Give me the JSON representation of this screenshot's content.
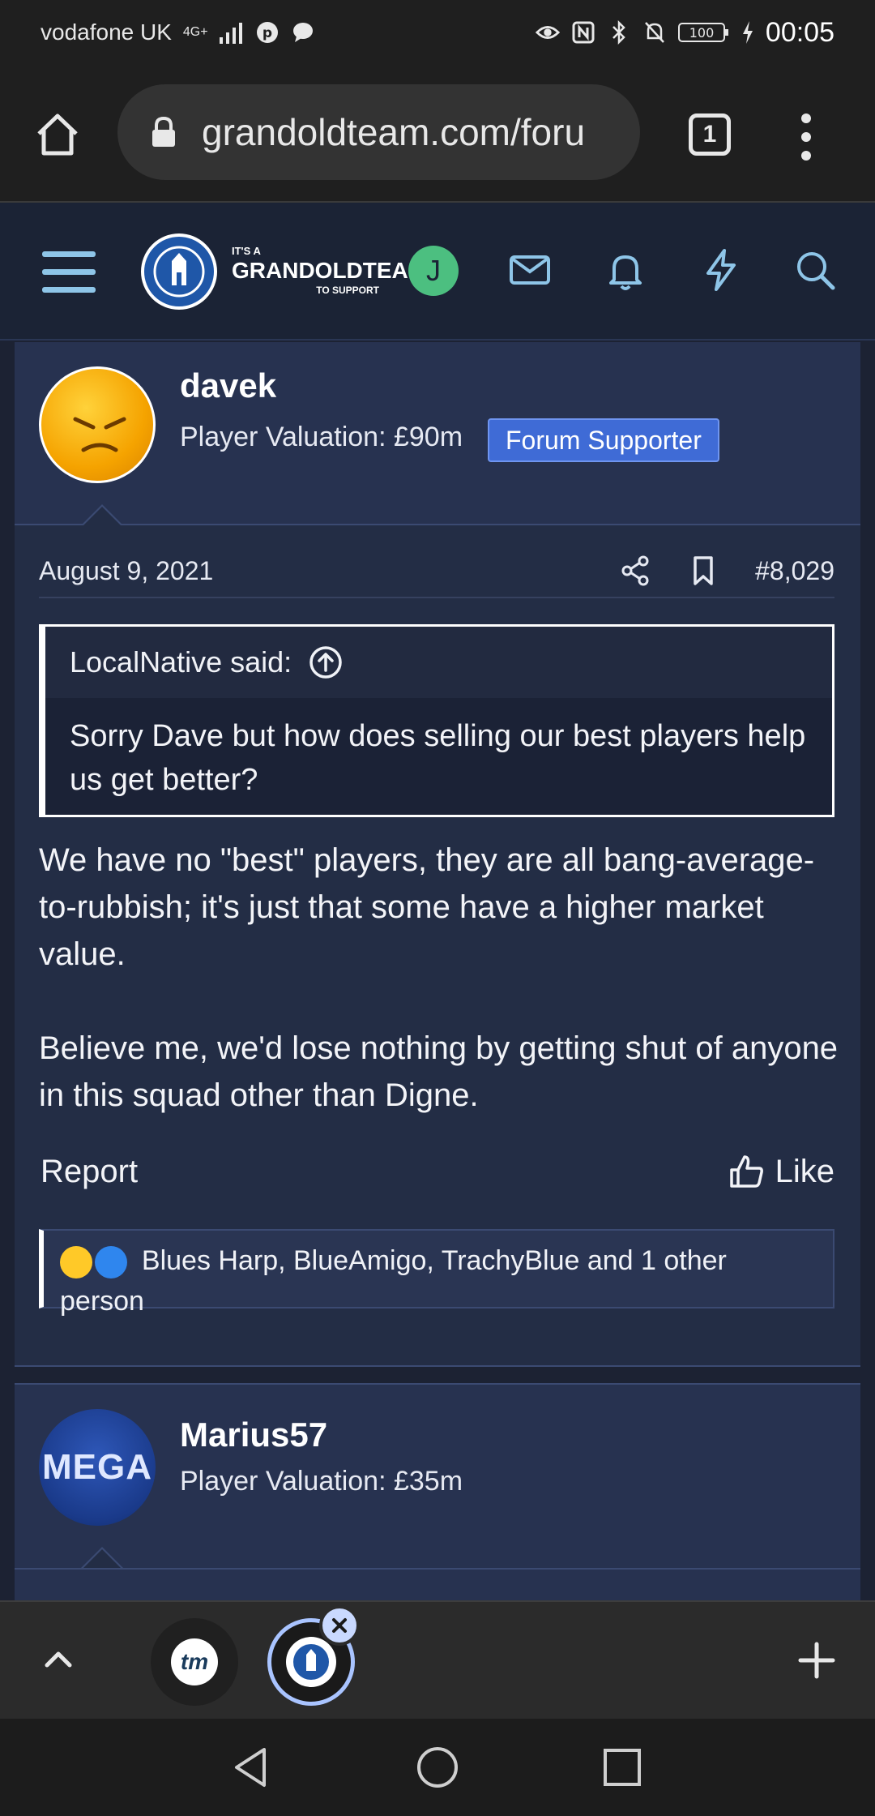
{
  "status_bar": {
    "carrier": "vodafone UK",
    "network": "4G+",
    "battery": "100",
    "time": "00:05"
  },
  "browser": {
    "url": "grandoldteam.com/foru",
    "tab_count": "1"
  },
  "site_header": {
    "logo_small_top": "IT'S A",
    "logo_big": "GRANDOLDTEAM",
    "logo_small_bottom": "TO SUPPORT",
    "user_initial": "J"
  },
  "post": {
    "author": "davek",
    "valuation": "Player Valuation: £90m",
    "badge": "Forum Supporter",
    "date": "August 9, 2021",
    "post_number": "#8,029",
    "quote_author": "LocalNative said:",
    "quote_text": "Sorry Dave but how does selling our best players help us get better?",
    "paragraphs": [
      "We have no \"best\" players, they are all bang-average-to-rubbish; it's just that some have a higher market value.",
      "Believe me, we'd lose nothing by getting shut of anyone in this squad other than Digne."
    ],
    "report_label": "Report",
    "like_label": "Like",
    "reactions_text": "Blues Harp, BlueAmigo, TrachyBlue and 1 other person"
  },
  "next_post": {
    "author": "Marius57",
    "valuation": "Player Valuation: £35m",
    "avatar_text": "MEGA"
  },
  "tab_switcher": {
    "tab1_label": "tm"
  },
  "colors": {
    "page_bg": "#1c2233",
    "card_bg": "#232d45",
    "author_strip": "#273250",
    "badge_blue": "#3f6bd6",
    "avatar_green": "#4cbf80"
  }
}
